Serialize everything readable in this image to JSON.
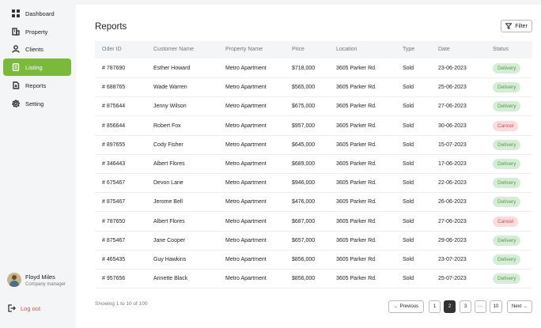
{
  "sidebar": {
    "items": [
      {
        "label": "Dashboard",
        "icon": "grid-icon",
        "active": false
      },
      {
        "label": "Property",
        "icon": "building-icon",
        "active": false
      },
      {
        "label": "Clients",
        "icon": "user-icon",
        "active": false
      },
      {
        "label": "Listing",
        "icon": "document-icon",
        "active": true
      },
      {
        "label": "Reports",
        "icon": "report-icon",
        "active": false
      },
      {
        "label": "Setting",
        "icon": "gear-icon",
        "active": false
      }
    ],
    "user": {
      "name": "Floyd Miles",
      "role": "Company manager"
    },
    "logout": "Log out"
  },
  "main": {
    "title": "Reports",
    "filter_label": "Filter",
    "columns": [
      "Oder ID",
      "Customer Name",
      "Property Name",
      "Price",
      "Location",
      "Type",
      "Date",
      "Status"
    ],
    "rows": [
      [
        "# 787690",
        "Esther Howard",
        "Metro Apartment",
        "$718,000",
        "3605 Parker Rd.",
        "Sold",
        "23-06-2023",
        "Delivery"
      ],
      [
        "# 688765",
        "Wade Warren",
        "Metro Apartment",
        "$565,000",
        "3605 Parker Rd.",
        "Sold",
        "25-06-2023",
        "Delivery"
      ],
      [
        "# 875644",
        "Jenny Wilson",
        "Metro Apartment",
        "$675,000",
        "3605 Parker Rd.",
        "Sold",
        "27-06-2023",
        "Delivery"
      ],
      [
        "# 856644",
        "Robert Fox",
        "Metro Apartment",
        "$957,000",
        "3605 Parker Rd.",
        "Sold",
        "30-06-2023",
        "Cancel"
      ],
      [
        "# 897655",
        "Cody Fisher",
        "Metro Apartment",
        "$645,000",
        "3605 Parker Rd.",
        "Sold",
        "15-07-2023",
        "Delivery"
      ],
      [
        "# 346443",
        "Albert Flores",
        "Metro Apartment",
        "$689,000",
        "3605 Parker Rd.",
        "Sold",
        "17-06-2023",
        "Delivery"
      ],
      [
        "# 675467",
        "Devon Lane",
        "Metro Apartment",
        "$946,000",
        "3605 Parker Rd.",
        "Sold",
        "22-06-2023",
        "Delivery"
      ],
      [
        "# 875467",
        "Jerome Bell",
        "Metro Apartment",
        "$476,000",
        "3605 Parker Rd.",
        "Sold",
        "26-06-2023",
        "Delivery"
      ],
      [
        "# 787650",
        "Albert Flores",
        "Metro Apartment",
        "$687,000",
        "3605 Parker Rd.",
        "Sold",
        "27-06-2023",
        "Cancel"
      ],
      [
        "# 875467",
        "Jane Cooper",
        "Metro Apartment",
        "$657,000",
        "3605 Parker Rd.",
        "Sold",
        "29-06-2023",
        "Delivery"
      ],
      [
        "# 465435",
        "Guy Hawkins",
        "Metro Apartment",
        "$856,000",
        "3605 Parker Rd.",
        "Sold",
        "23-07-2023",
        "Delivery"
      ],
      [
        "# 957656",
        "Annette Black",
        "Metro Apartment",
        "$856,000",
        "3605 Parker Rd.",
        "Sold",
        "25-07-2023",
        "Delivery"
      ]
    ],
    "showing": "Showing 1 to 10 of 100",
    "pagination": {
      "previous": "← Previous",
      "pages": [
        "1",
        "2",
        "3",
        "···",
        "10"
      ],
      "current": "2",
      "next": "Next →"
    }
  },
  "colors": {
    "accent": "#7bb93a",
    "delivery_bg": "#d5ecd6",
    "cancel_bg": "#fbdcdc",
    "logout": "#e0483e"
  }
}
